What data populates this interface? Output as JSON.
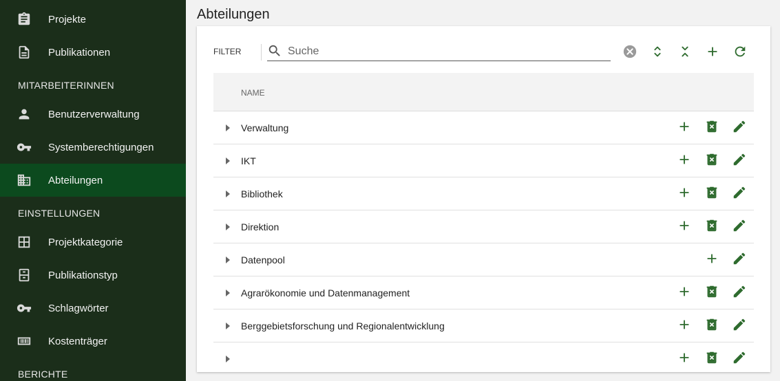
{
  "sidebar": {
    "items": [
      {
        "label": "Projekte",
        "icon": "clipboard-icon"
      },
      {
        "label": "Publikationen",
        "icon": "document-icon"
      },
      {
        "label": "Benutzerverwaltung",
        "icon": "person-icon"
      },
      {
        "label": "Systemberechtigungen",
        "icon": "key-icon"
      },
      {
        "label": "Abteilungen",
        "icon": "domain-icon",
        "active": true
      },
      {
        "label": "Projektkategorie",
        "icon": "grid-icon"
      },
      {
        "label": "Publikationstyp",
        "icon": "cabinet-icon"
      },
      {
        "label": "Schlagwörter",
        "icon": "key-icon"
      },
      {
        "label": "Kostenträger",
        "icon": "barcode-icon"
      }
    ],
    "sections": {
      "mitarbeiter": "MITARBEITERINNEN",
      "einstellungen": "EINSTELLUNGEN",
      "berichte": "BERICHTE"
    }
  },
  "page": {
    "title": "Abteilungen"
  },
  "toolbar": {
    "filter_label": "FILTER",
    "search_placeholder": "Suche",
    "search_value": "",
    "buttons": [
      "clear-icon",
      "expand-all-icon",
      "collapse-all-icon",
      "add-icon",
      "refresh-icon"
    ]
  },
  "table": {
    "column_name": "NAME",
    "rows": [
      {
        "name": "Verwaltung",
        "deletable": true
      },
      {
        "name": "IKT",
        "deletable": true
      },
      {
        "name": "Bibliothek",
        "deletable": true
      },
      {
        "name": "Direktion",
        "deletable": true
      },
      {
        "name": "Datenpool",
        "deletable": false
      },
      {
        "name": "Agrarökonomie und Datenmanagement",
        "deletable": true
      },
      {
        "name": "Berggebietsforschung und Regionalentwicklung",
        "deletable": true
      },
      {
        "name": "",
        "deletable": true
      }
    ]
  },
  "colors": {
    "sidebar_bg": "#1b2e1a",
    "sidebar_active": "#0c4a1e",
    "accent_green": "#2e6b2e"
  }
}
